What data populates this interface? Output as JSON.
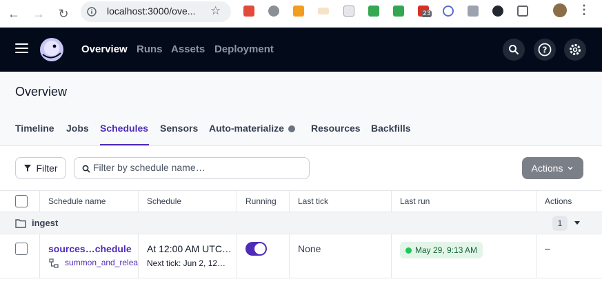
{
  "browser": {
    "url": "localhost:3000/ove...",
    "extension_badge": "23"
  },
  "app": {
    "nav": [
      "Overview",
      "Runs",
      "Assets",
      "Deployment"
    ]
  },
  "page": {
    "title": "Overview",
    "tabs": [
      "Timeline",
      "Jobs",
      "Schedules",
      "Sensors",
      "Auto-materialize",
      "Resources",
      "Backfills"
    ],
    "active_tab": "Schedules"
  },
  "toolbar": {
    "filter_label": "Filter",
    "search_placeholder": "Filter by schedule name…",
    "actions_label": "Actions"
  },
  "table": {
    "columns": [
      "Schedule name",
      "Schedule",
      "Running",
      "Last tick",
      "Last run",
      "Actions"
    ],
    "group": {
      "name": "ingest",
      "count": "1"
    },
    "rows": [
      {
        "name": "sources…chedule",
        "job": "summon_and_release",
        "cron": "At 12:00 AM UTC…",
        "next_tick": "Next tick: Jun 2, 12…",
        "running": true,
        "last_tick": "None",
        "last_run": "May 29, 9:13 AM",
        "actions": "–"
      }
    ]
  },
  "colors": {
    "accent": "#4f2bb8",
    "header_bg": "#030b1b",
    "success": "#22c55e"
  }
}
